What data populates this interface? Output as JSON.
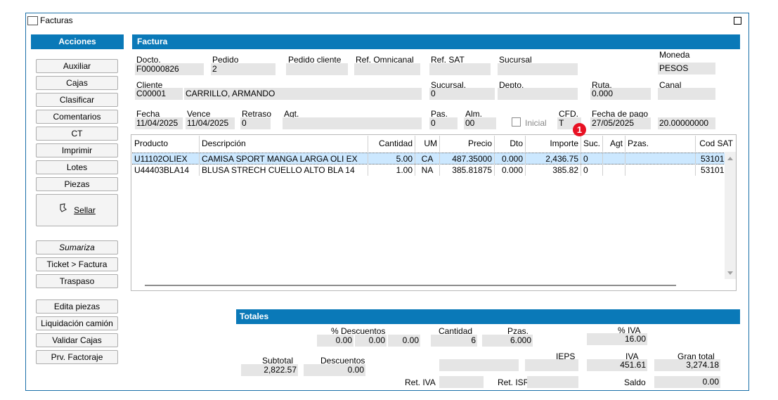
{
  "window": {
    "title": "Facturas"
  },
  "actions": {
    "title": "Acciones",
    "buttons": [
      "Auxiliar",
      "Cajas",
      "Clasificar",
      "Comentarios",
      "CT",
      "Imprimir",
      "Lotes",
      "Piezas"
    ],
    "sellar": "Sellar",
    "group2": [
      "Sumariza",
      "Ticket > Factura",
      "Traspaso"
    ],
    "group3": [
      "Edita piezas",
      "Liquidación camión",
      "Validar Cajas",
      "Prv. Factoraje"
    ]
  },
  "factura": {
    "title": "Factura",
    "docto_label": "Docto.",
    "docto": "F00000826",
    "pedido_label": "Pedido",
    "pedido": "2",
    "pedido_cliente_label": "Pedido cliente",
    "ref_omnicanal_label": "Ref. Omnicanal",
    "ref_sat_label": "Ref. SAT",
    "sucursal_label": "Sucursal",
    "moneda_label": "Moneda",
    "moneda": "PESOS",
    "cliente_label": "Cliente",
    "cliente_codigo": "C00001",
    "cliente_nombre": "CARRILLO, ARMANDO",
    "sucursal2_label": "Sucursal.",
    "sucursal2": "0",
    "depto_label": "Depto.",
    "ruta_label": "Ruta.",
    "ruta": "0.000",
    "canal_label": "Canal",
    "fecha_label": "Fecha",
    "fecha": "11/04/2025",
    "vence_label": "Vence",
    "vence": "11/04/2025",
    "retraso_label": "Retraso",
    "retraso": "0",
    "agt_label": "Agt.",
    "pas_label": "Pas.",
    "pas": "0",
    "alm_label": "Alm.",
    "alm": "00",
    "inicial_label": "Inicial",
    "cfd_label": "CFD.",
    "cfd": "T",
    "fecha_pago_label": "Fecha de pago",
    "fecha_pago": "27/05/2025",
    "tipo_cambio": "20.00000000",
    "badge": "1"
  },
  "grid": {
    "columns": [
      "Producto",
      "Descripción",
      "Cantidad",
      "UM",
      "Precio",
      "Dto",
      "Importe",
      "Suc.",
      "Agt",
      "Pzas.",
      "Cod SAT"
    ],
    "rows": [
      [
        "U11102OLIEX",
        "CAMISA SPORT MANGA LARGA OLI EX",
        "5.00",
        "CA",
        "487.35000",
        "0.000",
        "2,436.75",
        "0",
        "",
        "",
        "53101"
      ],
      [
        "U44403BLA14",
        "BLUSA STRECH CUELLO ALTO BLA 14",
        "1.00",
        "NA",
        "385.81875",
        "0.000",
        "385.82",
        "0",
        "",
        "",
        "53101"
      ]
    ]
  },
  "totales": {
    "title": "Totales",
    "pct_descuentos_label": "% Descuentos",
    "desc1": "0.00",
    "desc2": "0.00",
    "desc3": "0.00",
    "cantidad_label": "Cantidad",
    "cantidad": "6",
    "pzas_label": "Pzas.",
    "pzas": "6.000",
    "pct_iva_label": "% IVA",
    "pct_iva": "16.00",
    "subtotal_label": "Subtotal",
    "subtotal": "2,822.57",
    "descuentos_label": "Descuentos",
    "descuentos": "0.00",
    "ieps_label": "IEPS",
    "iva_label": "IVA",
    "iva": "451.61",
    "gran_total_label": "Gran total",
    "gran_total": "3,274.18",
    "ret_iva_label": "Ret. IVA",
    "ret_isr_label": "Ret. ISR",
    "saldo_label": "Saldo",
    "saldo": "0.00"
  },
  "colors": {
    "accent": "#0a79b8",
    "selected_row": "#cce8ff",
    "badge": "#e81123",
    "field": "#e5e5e5"
  }
}
